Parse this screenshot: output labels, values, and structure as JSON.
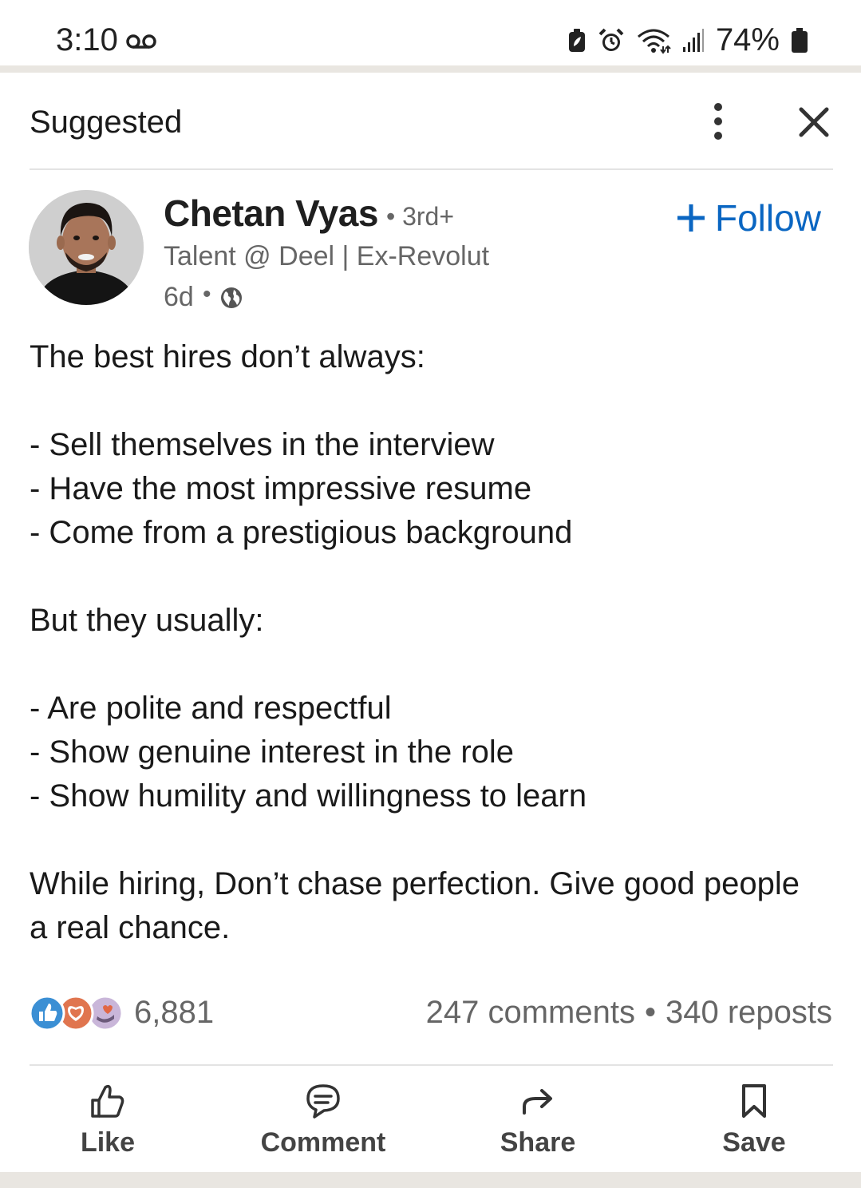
{
  "status_bar": {
    "time": "3:10",
    "battery": "74%",
    "icons": [
      "voicemail-icon",
      "battery-saver-icon",
      "alarm-icon",
      "wifi-icon",
      "signal-icon",
      "battery-icon"
    ]
  },
  "header": {
    "title": "Suggested",
    "icons": [
      "more-vertical-icon",
      "close-icon"
    ]
  },
  "author": {
    "name": "Chetan Vyas",
    "degree": "• 3rd+",
    "headline": "Talent @ Deel | Ex-Revolut",
    "time": "6d",
    "separator": "•",
    "visibility_icon": "globe-icon"
  },
  "follow": {
    "label": "Follow",
    "color": "#0a66c2"
  },
  "post": {
    "lines": [
      "The best hires don’t always:",
      "",
      "- Sell themselves in the interview",
      "- Have the most impressive resume",
      "- Come from a prestigious background",
      "",
      "But they usually:",
      "",
      "- Are polite and respectful",
      "- Show genuine interest in the role",
      "- Show humility and willingness to learn",
      "",
      "While hiring, Don’t chase perfection. Give good people",
      "a real chance."
    ]
  },
  "engagement": {
    "reaction_count": "6,881",
    "reaction_icons": [
      "like-reaction-icon",
      "love-reaction-icon",
      "support-reaction-icon"
    ],
    "comments": "247 comments",
    "separator": "•",
    "reposts": "340 reposts"
  },
  "actions": [
    {
      "label": "Like",
      "icon": "thumbs-up-icon"
    },
    {
      "label": "Comment",
      "icon": "comment-icon"
    },
    {
      "label": "Share",
      "icon": "share-arrow-icon"
    },
    {
      "label": "Save",
      "icon": "bookmark-icon"
    }
  ]
}
